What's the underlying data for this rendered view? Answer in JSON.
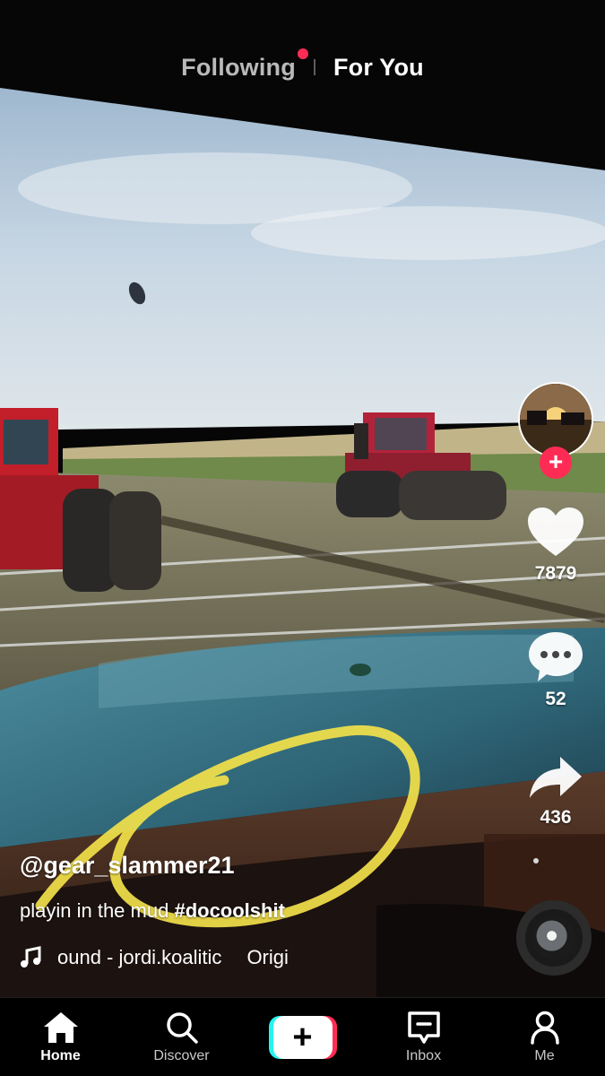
{
  "header": {
    "tabs": [
      {
        "label": "Following",
        "has_dot": true
      },
      {
        "label": "For You",
        "active": true
      }
    ]
  },
  "actions": {
    "likes": "7879",
    "comments": "52",
    "shares": "436"
  },
  "caption": {
    "username": "@gear_slammer21",
    "text": "playin in the mud",
    "hashtag": "#docoolshit",
    "sound_parts": [
      "ound - jordi.koalitic",
      "Origi"
    ]
  },
  "nav": {
    "home": "Home",
    "discover": "Discover",
    "create": "+",
    "inbox": "Inbox",
    "me": "Me"
  },
  "icons": {
    "music": "music-note-icon",
    "heart": "heart-icon",
    "comment": "comment-icon",
    "share": "share-icon"
  },
  "colors": {
    "accent": "#fe2c55",
    "cyan": "#25f4ee",
    "highlight_circle": "#f2e14a"
  }
}
